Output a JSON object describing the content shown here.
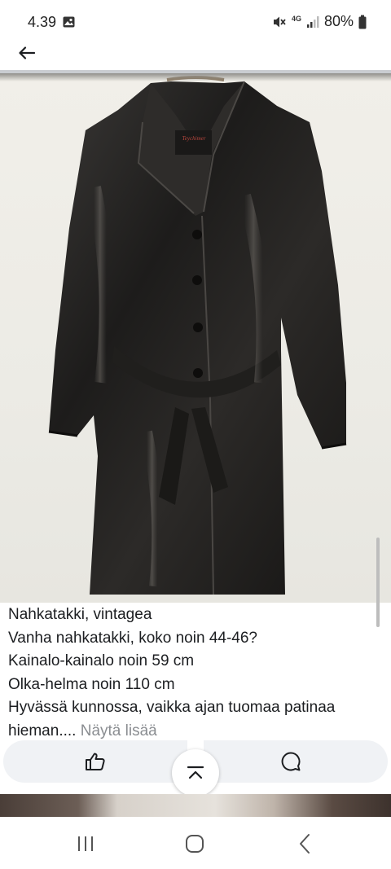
{
  "status_bar": {
    "time": "4.39",
    "network": "4G",
    "battery": "80%",
    "icons": [
      "gallery-icon",
      "mute-icon",
      "signal-icon",
      "battery-icon"
    ]
  },
  "top_bar": {
    "icons": [
      "back-arrow-icon"
    ]
  },
  "photo": {
    "subject": "leather-coat-photo"
  },
  "description": {
    "lines": [
      "Nahkatakki, vintagea",
      "Vanha nahkatakki, koko noin 44-46?",
      "Kainalo-kainalo noin 59 cm",
      "Olka-helma noin 110 cm",
      "Hyvässä kunnossa, vaikka ajan tuomaa patinaa",
      "hieman...."
    ],
    "see_more": "Näytä lisää"
  },
  "actions": {
    "icons": [
      "like-icon",
      "collapse-up-icon",
      "comment-icon"
    ]
  },
  "nav_bar": {
    "icons": [
      "recent-apps-icon",
      "home-icon",
      "back-icon"
    ]
  },
  "colors": {
    "text": "#1c1e21",
    "muted": "#8a8d91",
    "pill": "#f0f2f5",
    "divider": "#c9ccd1"
  }
}
